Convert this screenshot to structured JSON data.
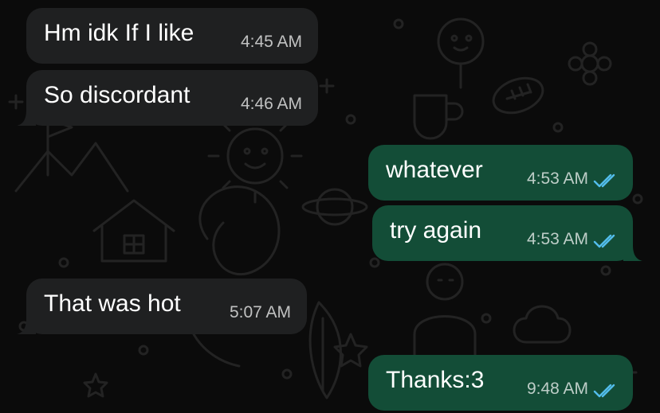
{
  "colors": {
    "background": "#0b0b0b",
    "incoming_bubble": "#1f2021",
    "outgoing_bubble": "#134d37",
    "read_ticks": "#53bdeb",
    "timestamp": "#bdbdbd"
  },
  "messages": [
    {
      "direction": "incoming",
      "text": "Hm idk If I like",
      "time": "4:45 AM"
    },
    {
      "direction": "incoming",
      "text": "So discordant",
      "time": "4:46 AM"
    },
    {
      "direction": "outgoing",
      "text": "whatever",
      "time": "4:53 AM",
      "status_icon": "double-check-read-icon"
    },
    {
      "direction": "outgoing",
      "text": "try again",
      "time": "4:53 AM",
      "status_icon": "double-check-read-icon"
    },
    {
      "direction": "incoming",
      "text": "That was hot",
      "time": "5:07 AM"
    },
    {
      "direction": "outgoing",
      "text": "Thanks:3",
      "time": "9:48 AM",
      "status_icon": "double-check-read-icon"
    }
  ]
}
